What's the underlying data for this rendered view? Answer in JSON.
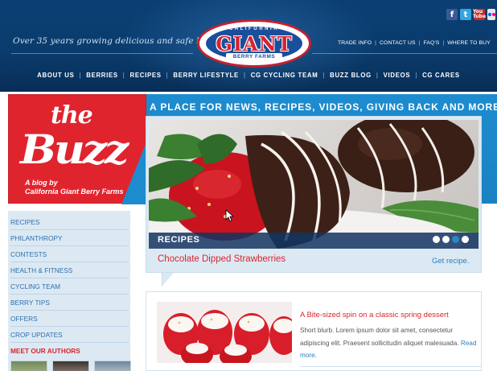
{
  "header": {
    "tagline": "Over 35 years growing delicious and safe berries",
    "logo": {
      "top": "CALIFORNIA",
      "main": "GIANT",
      "sub": "BERRY FARMS"
    },
    "social_icons": [
      "facebook-icon",
      "twitter-icon",
      "youtube-icon",
      "flickr-icon"
    ],
    "social_labels": {
      "facebook": "f",
      "twitter": "t",
      "youtube": "You Tube"
    },
    "utility_links": [
      "TRADE INFO",
      "CONTACT US",
      "FAQ'S",
      "WHERE TO BUY"
    ],
    "nav": [
      "ABOUT US",
      "BERRIES",
      "RECIPES",
      "BERRY LIFESTYLE",
      "CG CYCLING TEAM",
      "BUZZ BLOG",
      "VIDEOS",
      "CG CARES"
    ]
  },
  "banner": {
    "buzz_the": "the",
    "buzz_word": "Buzz",
    "buzz_by_line1": "A blog by",
    "buzz_by_line2": "California Giant Berry Farms",
    "caption": "A PLACE FOR NEWS, RECIPES, VIDEOS, GIVING BACK AND MORE."
  },
  "feature": {
    "label": "RECIPES",
    "title": "Chocolate Dipped Strawberries",
    "cta": "Get recipe.",
    "slides_total": 4,
    "slide_active": 3
  },
  "sidebar": {
    "items": [
      "RECIPES",
      "PHILANTHROPY",
      "CONTESTS",
      "HEALTH & FITNESS",
      "CYCLING TEAM",
      "BERRY TIPS",
      "OFFERS",
      "CROP UPDATES"
    ],
    "authors_heading": "MEET OUR AUTHORS"
  },
  "post": {
    "title": "A Bite-sized spin on a classic spring dessert",
    "body": "Short blurb. Lorem ipsum dolor sit amet, consectetur adipiscing elit. Praesent sollicitudin aliquet malesuada.",
    "more": "Read more."
  },
  "colors": {
    "header_navy": "#0a3c6d",
    "buzz_red": "#e0242e",
    "banner_blue": "#1d8ccf",
    "accent_red": "#d7262f",
    "link_blue": "#2b7fc0",
    "sidebar_bg": "#dce9f3"
  }
}
